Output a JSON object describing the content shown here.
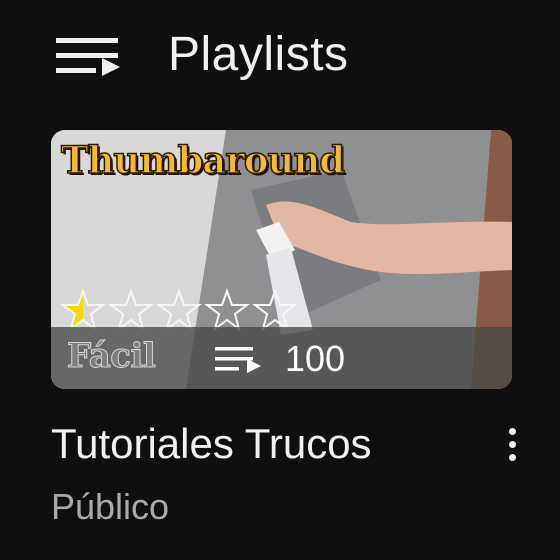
{
  "header": {
    "icon": "playlist-icon",
    "title": "Playlists"
  },
  "playlist": {
    "thumbnail": {
      "watermark": "Thumbaround",
      "rating": {
        "value": 0.5,
        "max": 5
      },
      "level_badge": "Fácil",
      "count_icon": "playlist-play-icon",
      "video_count": "100"
    },
    "title": "Tutoriales Trucos",
    "privacy": "Público",
    "more_icon": "more-vertical-icon"
  },
  "colors": {
    "background": "#0f0f0f",
    "text_primary": "#f1f1f1",
    "text_secondary": "#aaaaaa",
    "watermark": "#f4b935",
    "star_fill": "#f5d90a"
  }
}
